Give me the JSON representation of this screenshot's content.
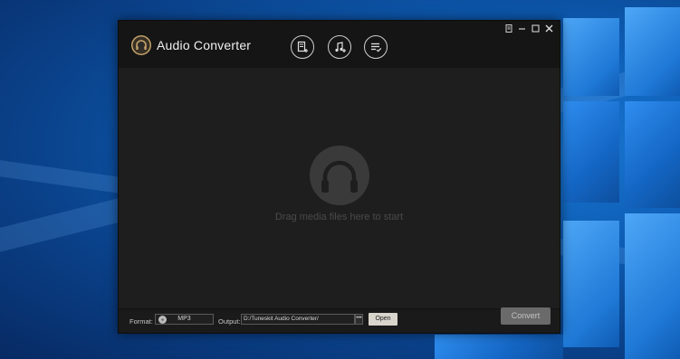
{
  "app": {
    "title": "Audio Converter",
    "accent": "#c5a46a"
  },
  "toolbar": {
    "buttons": [
      {
        "name": "add-files",
        "icon": "document-plus-icon"
      },
      {
        "name": "add-audio",
        "icon": "music-note-plus-icon"
      },
      {
        "name": "converted-list",
        "icon": "list-check-icon"
      }
    ]
  },
  "window_controls": [
    "menu-icon",
    "minimize-icon",
    "maximize-icon",
    "close-icon"
  ],
  "dropzone": {
    "hint": "Drag media files here to start"
  },
  "bottom": {
    "format_label": "Format:",
    "format_value": "MP3",
    "output_label": "Output:",
    "output_path": "D:/Tuneskit Audio Converter/",
    "browse_label": "•••",
    "open_label": "Open",
    "convert_label": "Convert"
  },
  "colors": {
    "window_bg": "#1d1d1d",
    "titlebar_bg": "#151515",
    "convert_button": "#6a6a6a",
    "open_button": "#d9d4cc",
    "desktop": "#0d5cb3"
  }
}
